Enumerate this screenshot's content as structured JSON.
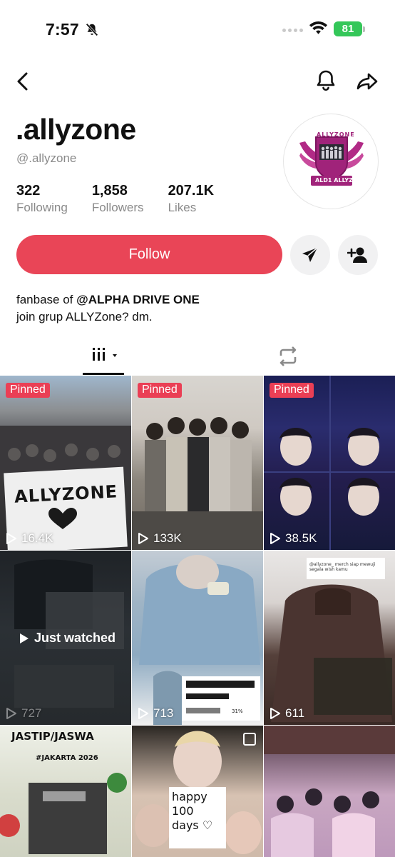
{
  "status_bar": {
    "time": "7:57",
    "battery": "81"
  },
  "profile": {
    "username": ".allyzone",
    "handle": "@.allyzone",
    "stats": [
      {
        "value": "322",
        "label": "Following"
      },
      {
        "value": "1,858",
        "label": "Followers"
      },
      {
        "value": "207.1K",
        "label": "Likes"
      }
    ],
    "follow_label": "Follow",
    "bio_line1_prefix": "fanbase of ",
    "bio_line1_mention": "@ALPHA DRIVE ONE",
    "bio_line2": "join grup ALLYZone? dm.",
    "avatar_text_top": "ALLYZONE",
    "avatar_text_bottom": "ALD1 ALLYZ"
  },
  "videos": [
    {
      "pinned": "Pinned",
      "views": "16.4K",
      "overlay": "ALLYZONE"
    },
    {
      "pinned": "Pinned",
      "views": "133K"
    },
    {
      "pinned": "Pinned",
      "views": "38.5K"
    },
    {
      "views": "727",
      "just_watched": "Just watched"
    },
    {
      "views": "713",
      "overlay_a": "69%",
      "overlay_b": "31%"
    },
    {
      "views": "611",
      "overlay": "@allyzone_ merch siap mewuji segala wish kamu"
    },
    {
      "overlay": "JASTIP/JASWA",
      "overlay_sub": "#JAKARTA 2026"
    },
    {
      "overlay": "happy 100 days ♡"
    },
    {}
  ],
  "colors": {
    "accent": "#e94557",
    "pinned": "#ea3f55",
    "battery": "#34c759"
  }
}
